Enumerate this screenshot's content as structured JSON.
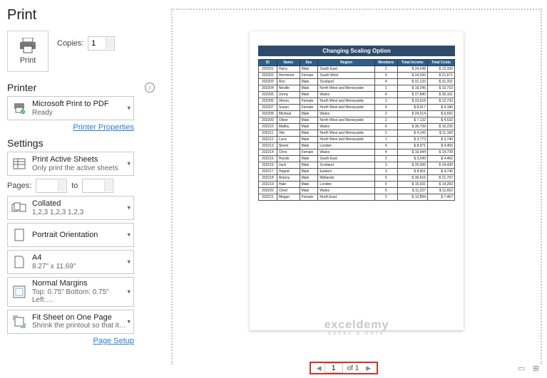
{
  "title": "Print",
  "print": {
    "label": "Print",
    "copies_label": "Copies:",
    "copies_value": "1"
  },
  "printer": {
    "header": "Printer",
    "name": "Microsoft Print to PDF",
    "status": "Ready",
    "props_link": "Printer Properties"
  },
  "settings": {
    "header": "Settings",
    "sheets": {
      "main": "Print Active Sheets",
      "sub": "Only print the active sheets"
    },
    "pages": {
      "label": "Pages:",
      "to": "to",
      "from": "",
      "until": ""
    },
    "collate": {
      "main": "Collated",
      "sub": "1,2,3   1,2,3   1,2,3"
    },
    "orient": {
      "main": "Portrait Orientation",
      "sub": ""
    },
    "paper": {
      "main": "A4",
      "sub": "8.27\" x 11.69\""
    },
    "margins": {
      "main": "Normal Margins",
      "sub": "Top: 0.75\" Bottom: 0.75\" Left:…"
    },
    "scale": {
      "main": "Fit Sheet on One Page",
      "sub": "Shrink the printout so that it…"
    },
    "setup_link": "Page Setup"
  },
  "nav": {
    "page": "1",
    "of": "of 1"
  },
  "chart_data": {
    "type": "table",
    "title": "Changing Scaling Option",
    "columns": [
      "ID",
      "Name",
      "Sex",
      "Region",
      "Members",
      "Total Income",
      "Total Costs"
    ],
    "rows": [
      [
        "202201",
        "Harry",
        "Male",
        "South East",
        "2",
        "$   24,248",
        "$   13,336"
      ],
      [
        "202202",
        "Hermione",
        "Female",
        "South West",
        "0",
        "$   24,200",
        "$   21,671"
      ],
      [
        "202203",
        "Ron",
        "Male",
        "Scotland",
        "4",
        "$   31,133",
        "$   31,331"
      ],
      [
        "202204",
        "Neville",
        "Male",
        "North West and Merseyside",
        "1",
        "$   19,245",
        "$   10,710"
      ],
      [
        "202205",
        "Jonny",
        "Male",
        "Wales",
        "4",
        "$   27,840",
        "$   30,101"
      ],
      [
        "202206",
        "Vitoria",
        "Female",
        "North West and Merseyside",
        "3",
        "$   23,618",
        "$   12,733"
      ],
      [
        "202207",
        "Susan",
        "Female",
        "North West and Merseyside",
        "4",
        "$    8,917",
        "$    4,180"
      ],
      [
        "202208",
        "Micheal",
        "Male",
        "Wales",
        "2",
        "$   24,214",
        "$    6,691"
      ],
      [
        "202209",
        "Oliver",
        "Male",
        "North West and Merseyside",
        "2",
        "$    7,132",
        "$    4,532"
      ],
      [
        "202210",
        "Malfoy",
        "Male",
        "Wales",
        "6",
        "$   36,739",
        "$   16,235"
      ],
      [
        "202211",
        "Vito",
        "Male",
        "North West and Merseyside",
        "2",
        "$    4,142",
        "$   11,160"
      ],
      [
        "202212",
        "Luca",
        "Male",
        "North West and Merseyside",
        "1",
        "$    3,773",
        "$    3,740"
      ],
      [
        "202213",
        "Street",
        "Male",
        "London",
        "4",
        "$    8,971",
        "$    4,455"
      ],
      [
        "202214",
        "Chris",
        "Female",
        "Wales",
        "4",
        "$   19,944",
        "$   14,739"
      ],
      [
        "202215",
        "Hundo",
        "Male",
        "South East",
        "2",
        "$    3,249",
        "$    4,462"
      ],
      [
        "202216",
        "Jack",
        "Male",
        "Scotland",
        "3",
        "$   25,436",
        "$   24,430"
      ],
      [
        "202217",
        "Hagrid",
        "Male",
        "Eastern",
        "3",
        "$    8,951",
        "$    4,745"
      ],
      [
        "202218",
        "Antony",
        "Male",
        "Midlands",
        "5",
        "$   36,616",
        "$   21,797"
      ],
      [
        "202219",
        "Hale",
        "Male",
        "London",
        "0",
        "$   15,031",
        "$   14,283"
      ],
      [
        "202220",
        "Ched",
        "Male",
        "Wales",
        "5",
        "$   11,237",
        "$   11,652"
      ],
      [
        "202221",
        "Megan",
        "Female",
        "North East",
        "2",
        "$   12,894",
        "$    7,467"
      ]
    ]
  },
  "watermark": {
    "main": "exceldemy",
    "sub": "EXCEL & DATA"
  }
}
